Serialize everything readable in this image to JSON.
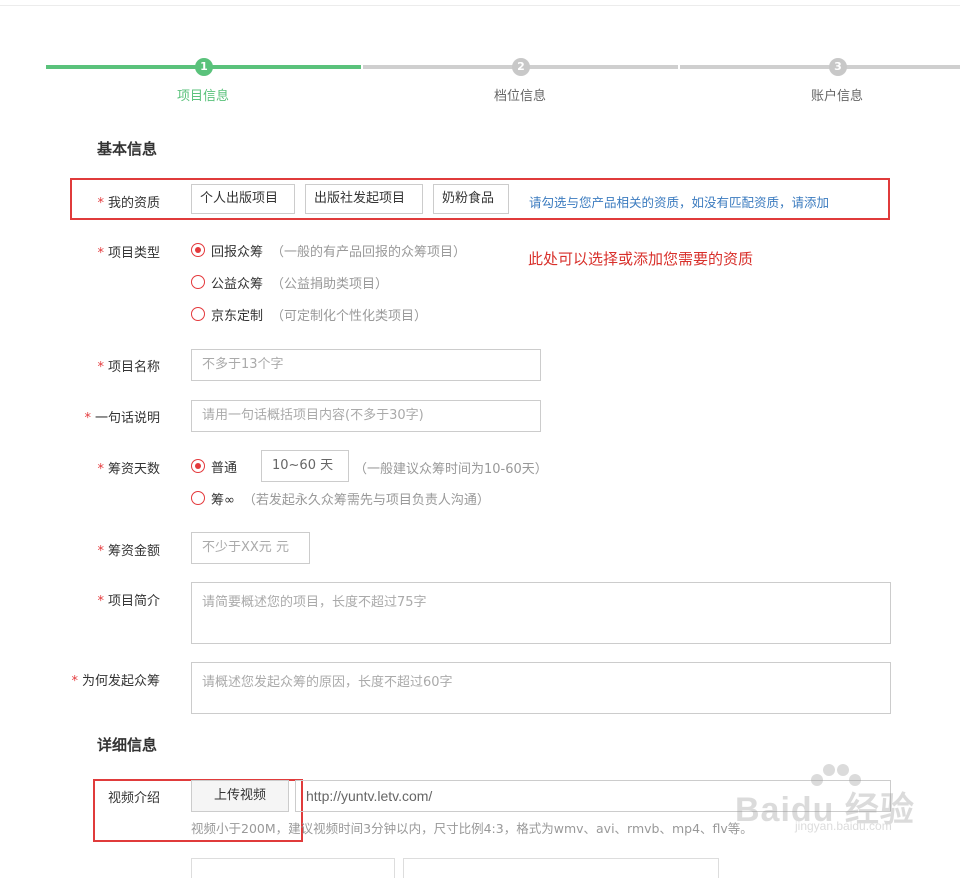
{
  "steps": [
    {
      "num": "1",
      "label": "项目信息",
      "active": true
    },
    {
      "num": "2",
      "label": "档位信息",
      "active": false
    },
    {
      "num": "3",
      "label": "账户信息",
      "active": false
    }
  ],
  "colors": {
    "accent": "#5ac27b",
    "required": "#e4393c",
    "link": "#3b7bbf",
    "annotation": "#d8302b"
  },
  "basic": {
    "title": "基本信息",
    "qualification": {
      "label": "我的资质",
      "tags": [
        "个人出版项目",
        "出版社发起项目",
        "奶粉食品"
      ],
      "link": "请勾选与您产品相关的资质，如没有匹配资质，请添加"
    },
    "annotation": "此处可以选择或添加您需要的资质",
    "project_type": {
      "label": "项目类型",
      "options": [
        {
          "label": "回报众筹",
          "hint": "（一般的有产品回报的众筹项目）",
          "selected": true
        },
        {
          "label": "公益众筹",
          "hint": "（公益捐助类项目）",
          "selected": false
        },
        {
          "label": "京东定制",
          "hint": "（可定制化个性化类项目）",
          "selected": false
        }
      ]
    },
    "project_name": {
      "label": "项目名称",
      "placeholder": "不多于13个字"
    },
    "one_line": {
      "label": "一句话说明",
      "placeholder": "请用一句话概括项目内容(不多于30字)"
    },
    "days": {
      "label": "筹资天数",
      "normal": "普通",
      "value": "10~60  天",
      "hint": "（一般建议众筹时间为10-60天）",
      "forever": "筹∞",
      "forever_hint": "（若发起永久众筹需先与项目负责人沟通）"
    },
    "amount": {
      "label": "筹资金额",
      "placeholder": "不少于XX元  元"
    },
    "intro": {
      "label": "项目简介",
      "placeholder": "请简要概述您的项目，长度不超过75字"
    },
    "why": {
      "label": "为何发起众筹",
      "placeholder": "请概述您发起众筹的原因，长度不超过60字"
    }
  },
  "detail": {
    "title": "详细信息",
    "video": {
      "label": "视频介绍",
      "upload": "上传视频",
      "url": "http://yuntv.letv.com/",
      "hint": "视频小于200M，建议视频时间3分钟以内，尺寸比例4:3，格式为wmv、avi、rmvb、mp4、flv等。"
    }
  },
  "watermark": {
    "brand": "Baidu 经验",
    "site": "jingyan.baidu.com"
  }
}
